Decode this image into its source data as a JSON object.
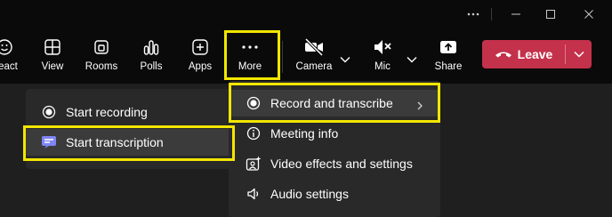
{
  "window": {
    "controls": {
      "more_icon": "ellipsis-icon",
      "minimize_icon": "minimize-icon",
      "maximize_icon": "maximize-icon",
      "close_icon": "close-icon"
    }
  },
  "toolbar": {
    "react_label": "eact",
    "view_label": "View",
    "rooms_label": "Rooms",
    "polls_label": "Polls",
    "apps_label": "Apps",
    "more_label": "More",
    "camera_label": "Camera",
    "mic_label": "Mic",
    "share_label": "Share",
    "leave_label": "Leave"
  },
  "more_menu": {
    "items": [
      {
        "label": "Record and transcribe",
        "icon": "record-icon",
        "has_submenu": true,
        "highlighted": true
      },
      {
        "label": "Meeting info",
        "icon": "info-icon"
      },
      {
        "label": "Video effects and settings",
        "icon": "video-effects-icon"
      },
      {
        "label": "Audio settings",
        "icon": "speaker-icon"
      }
    ]
  },
  "record_submenu": {
    "items": [
      {
        "label": "Start recording",
        "icon": "record-icon"
      },
      {
        "label": "Start transcription",
        "icon": "transcription-icon",
        "highlighted": true,
        "icon_color": "#7f85f5"
      }
    ]
  },
  "colors": {
    "leave": "#c4314b",
    "highlight_box": "#f2e600",
    "accent": "#7f85f5"
  }
}
